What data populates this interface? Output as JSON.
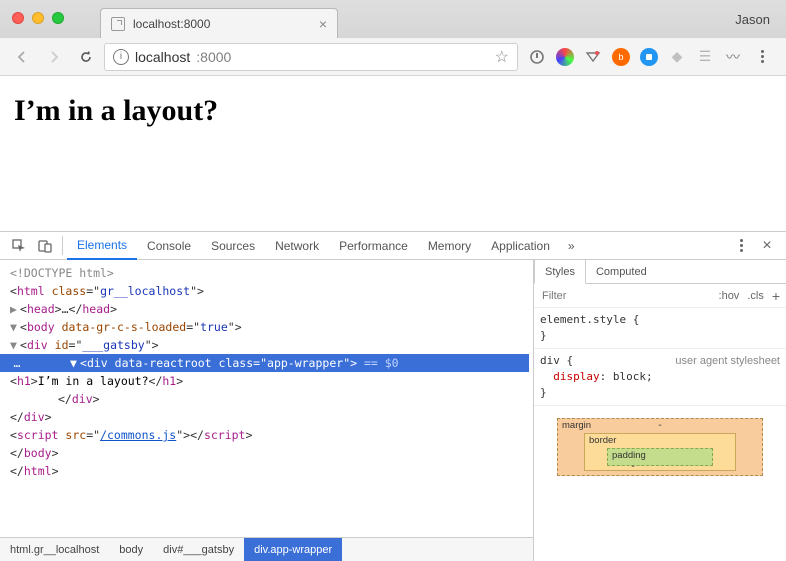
{
  "chrome": {
    "profile_name": "Jason",
    "tab": {
      "title": "localhost:8000",
      "close_glyph": "×"
    },
    "url": {
      "host": "localhost",
      "path": ":8000"
    },
    "star_glyph": "☆",
    "menu_aria": "Chrome menu"
  },
  "page": {
    "heading": "I’m in a layout?"
  },
  "devtools": {
    "tabs": [
      "Elements",
      "Console",
      "Sources",
      "Network",
      "Performance",
      "Memory",
      "Application"
    ],
    "active_tab": "Elements",
    "overflow_glyph": "»",
    "close_glyph": "×",
    "dom": {
      "doctype": "<!DOCTYPE html>",
      "html_open": "html",
      "html_class": "gr__localhost",
      "head_ellipsis": "…",
      "body_attr_name": "data-gr-c-s-loaded",
      "body_attr_val": "true",
      "div_id": "___gatsby",
      "sel_attr1_name": "data-reactroot",
      "sel_class": "app-wrapper",
      "sel_suffix": " == $0",
      "h1_text": "I’m in a layout?",
      "script_src": "/commons.js",
      "tag_html": "html",
      "tag_head": "head",
      "tag_body": "body",
      "tag_div": "div",
      "tag_h1": "h1",
      "tag_script": "script",
      "attr_class": "class",
      "attr_id": "id",
      "attr_src": "src"
    },
    "crumbs": [
      "html.gr__localhost",
      "body",
      "div#___gatsby",
      "div.app-wrapper"
    ],
    "styles": {
      "tabs": [
        "Styles",
        "Computed"
      ],
      "filter_placeholder": "Filter",
      "hov": ":hov",
      "cls": ".cls",
      "plus": "+",
      "rule1_sel": "element.style",
      "rule1_open": " {",
      "rule1_close": "}",
      "rule2_sel": "div",
      "rule2_ua": "user agent stylesheet",
      "rule2_prop": "display",
      "rule2_val": "block",
      "box": {
        "margin": "margin",
        "border": "border",
        "padding": "padding",
        "dash": "-"
      }
    }
  }
}
